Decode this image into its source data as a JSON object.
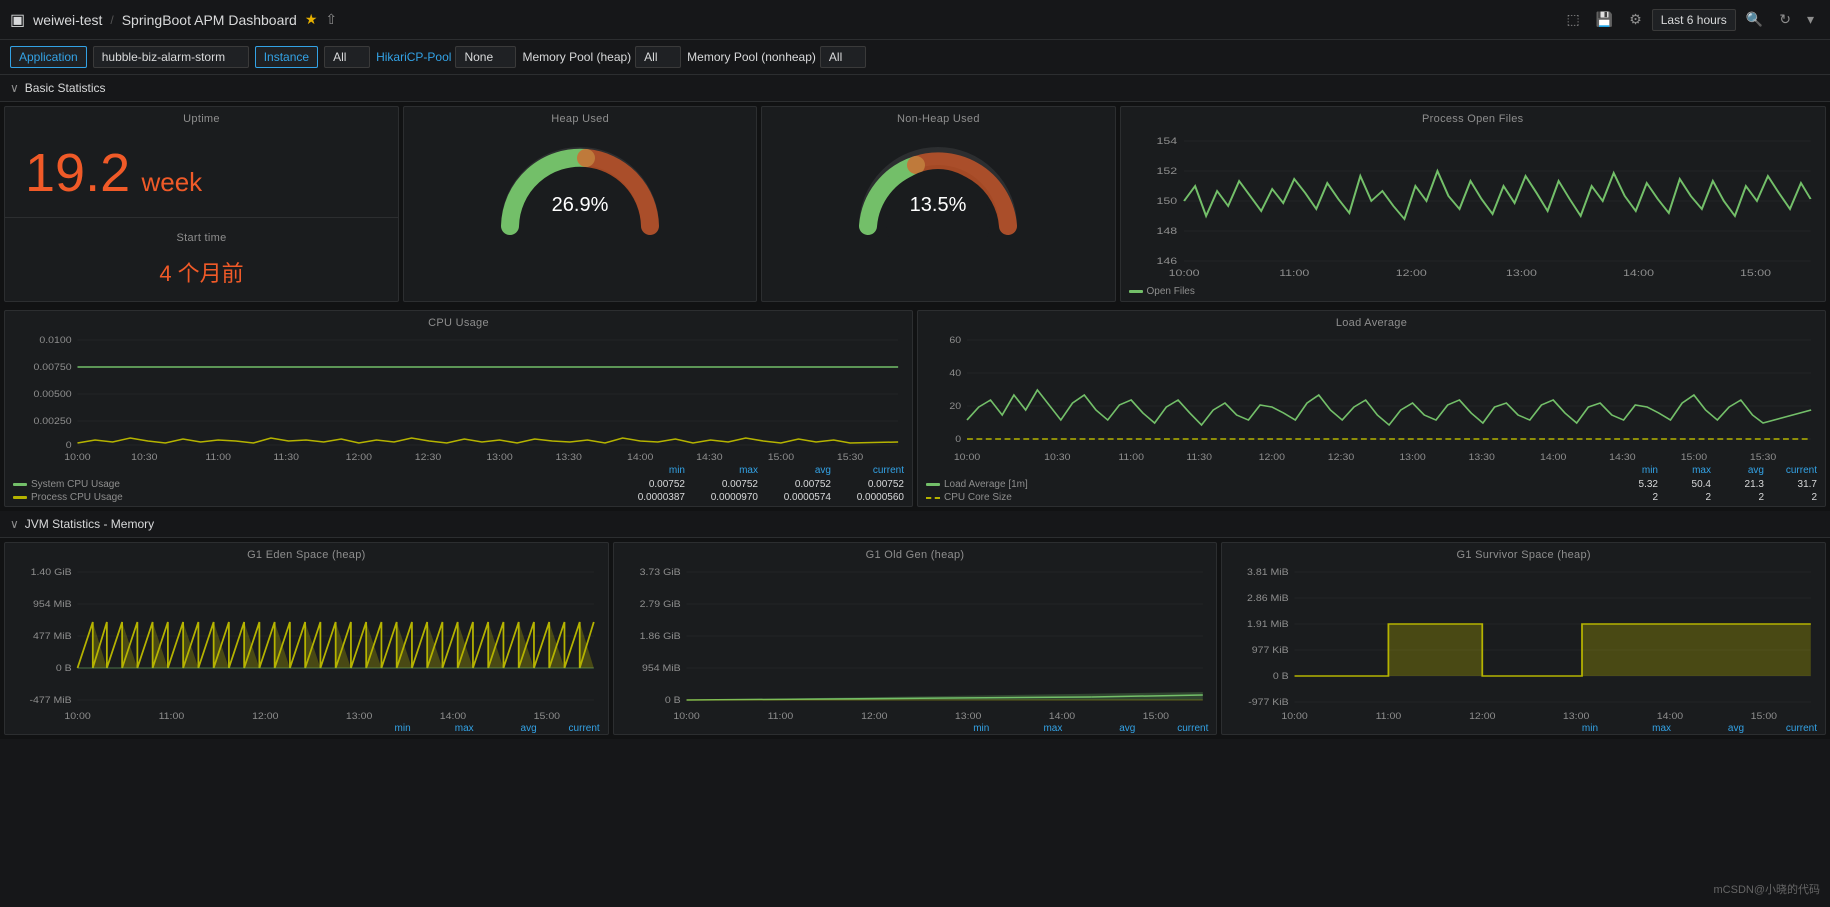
{
  "topbar": {
    "org": "weiwei-test",
    "separator": "/",
    "title": "SpringBoot APM Dashboard",
    "time_label": "Last 6 hours"
  },
  "filterbar": {
    "application_label": "Application",
    "application_value": "hubble-biz-alarm-storm",
    "instance_label": "Instance",
    "instance_all": "All",
    "hikari_label": "HikariCP-Pool",
    "hikari_value": "None",
    "memory_heap_label": "Memory Pool (heap)",
    "memory_heap_all": "All",
    "memory_nonheap_label": "Memory Pool (nonheap)",
    "memory_nonheap_all": "All"
  },
  "sections": {
    "basic": "∨ Basic Statistics",
    "jvm": "∨ JVM Statistics - Memory"
  },
  "uptime": {
    "title": "Uptime",
    "value": "19.2",
    "unit": "week",
    "start_time_title": "Start time",
    "start_time_value": "4 个月前"
  },
  "heap_used": {
    "title": "Heap Used",
    "value": "26.9%",
    "pct": 26.9
  },
  "nonheap_used": {
    "title": "Non-Heap Used",
    "value": "13.5%",
    "pct": 13.5
  },
  "process_files": {
    "title": "Process Open Files",
    "legend": "Open Files",
    "y_min": 146,
    "y_max": 154,
    "times": [
      "10:00",
      "11:00",
      "12:00",
      "13:00",
      "14:00",
      "15:00"
    ]
  },
  "cpu_usage": {
    "title": "CPU Usage",
    "y_labels": [
      "0.0100",
      "0.00750",
      "0.00500",
      "0.00250",
      "0"
    ],
    "x_labels": [
      "10:00",
      "10:30",
      "11:00",
      "11:30",
      "12:00",
      "12:30",
      "13:00",
      "13:30",
      "14:00",
      "14:30",
      "15:00",
      "15:30"
    ],
    "series": [
      {
        "label": "System CPU Usage",
        "color": "#73bf69"
      },
      {
        "label": "Process CPU Usage",
        "color": "#b5b300"
      }
    ],
    "stats_headers": [
      "min",
      "max",
      "avg",
      "current"
    ],
    "stats": [
      {
        "label": "System CPU Usage",
        "color": "#73bf69",
        "min": "0.00752",
        "max": "0.00752",
        "avg": "0.00752",
        "current": "0.00752"
      },
      {
        "label": "Process CPU Usage",
        "color": "#b5b300",
        "min": "0.0000387",
        "max": "0.0000970",
        "avg": "0.0000574",
        "current": "0.0000560"
      }
    ]
  },
  "load_average": {
    "title": "Load Average",
    "y_labels": [
      "60",
      "40",
      "20",
      "0"
    ],
    "x_labels": [
      "10:00",
      "10:30",
      "11:00",
      "11:30",
      "12:00",
      "12:30",
      "13:00",
      "13:30",
      "14:00",
      "14:30",
      "15:00",
      "15:30"
    ],
    "series": [
      {
        "label": "Load Average [1m]",
        "color": "#73bf69"
      },
      {
        "label": "CPU Core Size",
        "color": "#b5b300",
        "dashed": true
      }
    ],
    "stats_headers": [
      "min",
      "max",
      "avg",
      "current"
    ],
    "stats": [
      {
        "label": "Load Average [1m]",
        "color": "#73bf69",
        "min": "5.32",
        "max": "50.4",
        "avg": "21.3",
        "current": "31.7"
      },
      {
        "label": "CPU Core Size",
        "color": "#b5b300",
        "min": "2",
        "max": "2",
        "avg": "2",
        "current": "2"
      }
    ]
  },
  "g1_eden": {
    "title": "G1 Eden Space (heap)",
    "y_labels": [
      "1.40 GiB",
      "954 MiB",
      "477 MiB",
      "0 B",
      "-477 MiB"
    ],
    "x_labels": [
      "10:00",
      "11:00",
      "12:00",
      "13:00",
      "14:00",
      "15:00"
    ],
    "stats_headers": [
      "min",
      "max",
      "avg",
      "current"
    ],
    "color": "#b5b300"
  },
  "g1_old": {
    "title": "G1 Old Gen (heap)",
    "y_labels": [
      "3.73 GiB",
      "2.79 GiB",
      "1.86 GiB",
      "954 MiB",
      "0 B"
    ],
    "x_labels": [
      "10:00",
      "11:00",
      "12:00",
      "13:00",
      "14:00",
      "15:00"
    ],
    "color": "#73bf69"
  },
  "g1_survivor": {
    "title": "G1 Survivor Space (heap)",
    "y_labels": [
      "3.81 MiB",
      "2.86 MiB",
      "1.91 MiB",
      "977 KiB",
      "0 B",
      "-977 KiB"
    ],
    "x_labels": [
      "10:00",
      "11:00",
      "12:00",
      "13:00",
      "14:00",
      "15:00"
    ],
    "color": "#b5b300"
  },
  "watermark": "mCSDN@小晓的代码"
}
